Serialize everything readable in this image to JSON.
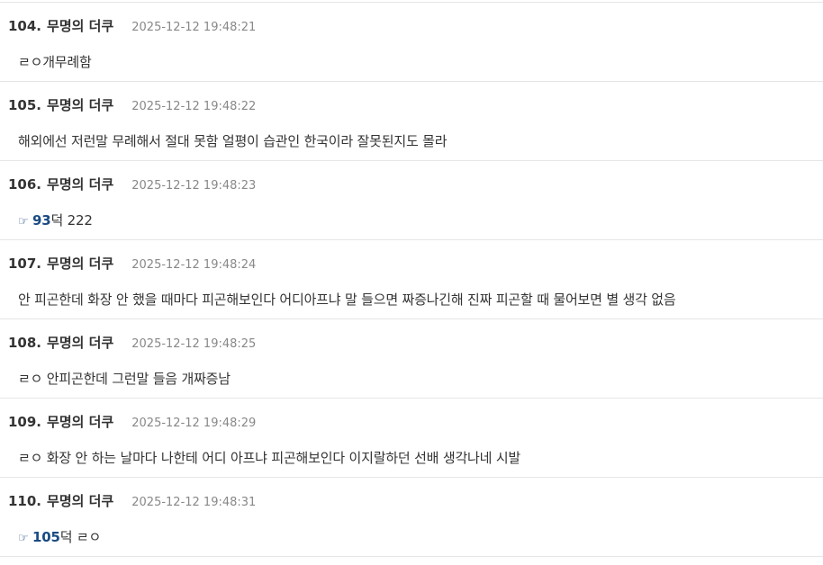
{
  "posts": [
    {
      "num": "104.",
      "author": "무명의 더쿠",
      "time": "2025-12-12 19:48:21",
      "body": "ㄹㅇ개무례함"
    },
    {
      "num": "105.",
      "author": "무명의 더쿠",
      "time": "2025-12-12 19:48:22",
      "body": "해외에선 저런말 무례해서 절대 못함 얼평이 습관인 한국이라 잘못된지도 몰라"
    },
    {
      "num": "106.",
      "author": "무명의 더쿠",
      "time": "2025-12-12 19:48:23",
      "anchor_icon": "☞",
      "anchor_num": "93",
      "anchor_suffix": "덕",
      "body": " 222"
    },
    {
      "num": "107.",
      "author": "무명의 더쿠",
      "time": "2025-12-12 19:48:24",
      "body": "안 피곤한데 화장 안 했을 때마다 피곤해보인다 어디아프냐 말 들으면 짜증나긴해 진짜 피곤할 때 물어보면 별 생각 없음"
    },
    {
      "num": "108.",
      "author": "무명의 더쿠",
      "time": "2025-12-12 19:48:25",
      "body": "ㄹㅇ 안피곤한데 그런말 들음 개짜증남"
    },
    {
      "num": "109.",
      "author": "무명의 더쿠",
      "time": "2025-12-12 19:48:29",
      "body": "ㄹㅇ 화장 안 하는 날마다 나한테 어디 아프냐 피곤해보인다 이지랄하던 선배 생각나네 시발"
    },
    {
      "num": "110.",
      "author": "무명의 더쿠",
      "time": "2025-12-12 19:48:31",
      "anchor_icon": "☞",
      "anchor_num": "105",
      "anchor_suffix": "덕",
      "body": " ㄹㅇ"
    }
  ],
  "colors": {
    "anchor": "#1a4a82",
    "time": "#888888",
    "text": "#333333",
    "divider": "#e6e6e6"
  },
  "icons": {
    "anchor": "pointing-hand-icon"
  }
}
